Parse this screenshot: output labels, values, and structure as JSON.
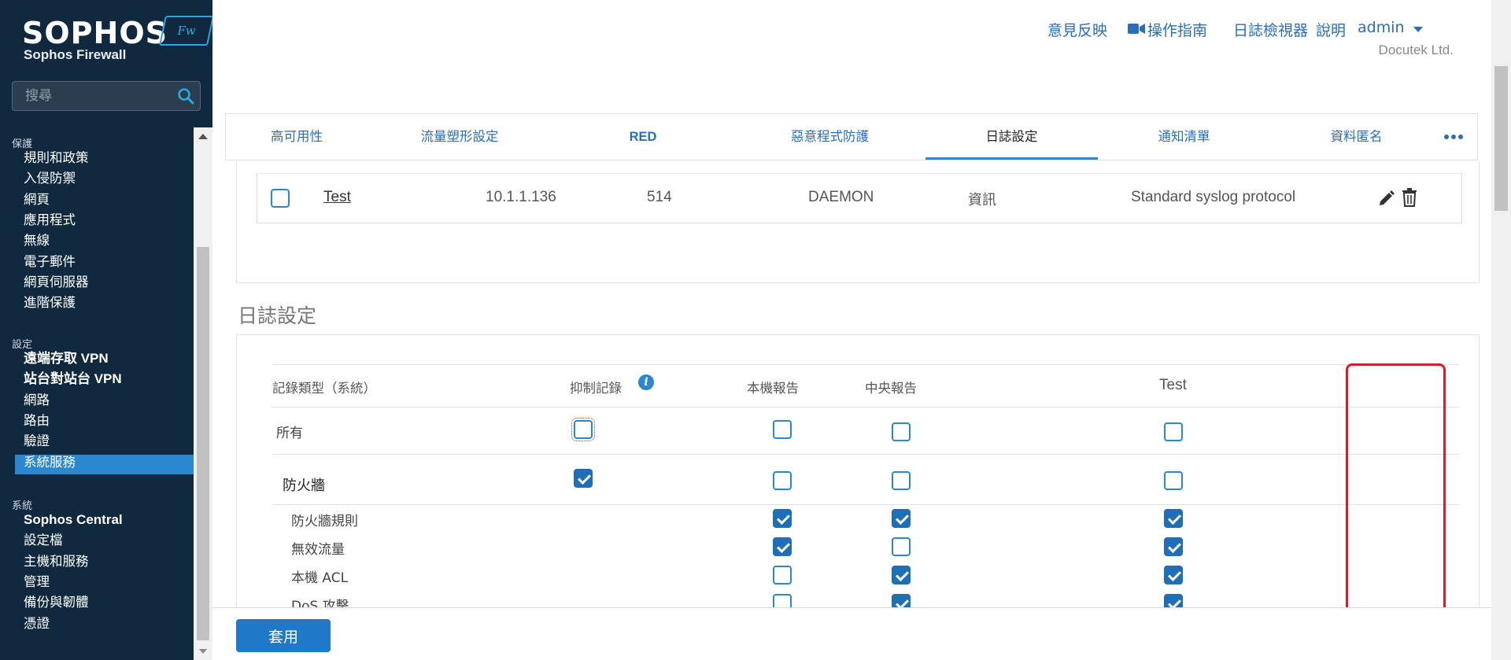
{
  "app": {
    "logo_text": "SOPHOS",
    "logo_badge": "Fw",
    "logo_subtitle": "Sophos Firewall"
  },
  "search": {
    "placeholder": "搜尋"
  },
  "sidebar": {
    "sections": [
      {
        "title": "保護",
        "items": [
          "規則和政策",
          "入侵防禦",
          "網頁",
          "應用程式",
          "無線",
          "電子郵件",
          "網頁伺服器",
          "進階保護"
        ]
      },
      {
        "title": "設定",
        "items": [
          "遠端存取 VPN",
          "站台對站台 VPN",
          "網路",
          "路由",
          "驗證",
          "系統服務"
        ]
      },
      {
        "title": "系統",
        "items": [
          "Sophos Central",
          "設定檔",
          "主機和服務",
          "管理",
          "備份與韌體",
          "憑證"
        ]
      }
    ],
    "active_item": "系統服務"
  },
  "header": {
    "links": [
      "意見反映",
      "操作指南",
      "日誌檢視器",
      "說明",
      "admin"
    ],
    "company": "Docutek Ltd."
  },
  "tabs": {
    "items": [
      "高可用性",
      "流量塑形設定",
      "RED",
      "惡意程式防護",
      "日誌設定",
      "通知清單",
      "資料匿名"
    ],
    "active": "日誌設定",
    "more_icon": "more-dots-icon"
  },
  "syslog_server": {
    "name": "Test",
    "ip": "10.1.1.136",
    "port": "514",
    "facility": "DAEMON",
    "severity": "資訊",
    "format": "Standard syslog protocol",
    "selected": false
  },
  "log_settings": {
    "title": "日誌設定",
    "columns": {
      "type": "記錄類型（系統）",
      "suppress": "抑制記錄",
      "local": "本機報告",
      "central": "中央報告",
      "test": "Test"
    },
    "rows": [
      {
        "label": "所有",
        "suppress": false,
        "local": false,
        "central": false,
        "test": false
      },
      {
        "label": "防火牆",
        "suppress": true,
        "local": false,
        "central": false,
        "test": false
      },
      {
        "label": "防火牆規則",
        "suppress": null,
        "local": true,
        "central": true,
        "test": true
      },
      {
        "label": "無效流量",
        "suppress": null,
        "local": true,
        "central": false,
        "test": true
      },
      {
        "label": "本機 ACL",
        "suppress": null,
        "local": false,
        "central": true,
        "test": true
      },
      {
        "label": "DoS 攻擊",
        "suppress": null,
        "local": false,
        "central": true,
        "test": true
      }
    ]
  },
  "footer": {
    "apply_label": "套用"
  },
  "colors": {
    "accent": "#1f78c8",
    "sidebar_bg": "#10293f",
    "highlight": "#d4202b",
    "link": "#2a6ebb"
  }
}
